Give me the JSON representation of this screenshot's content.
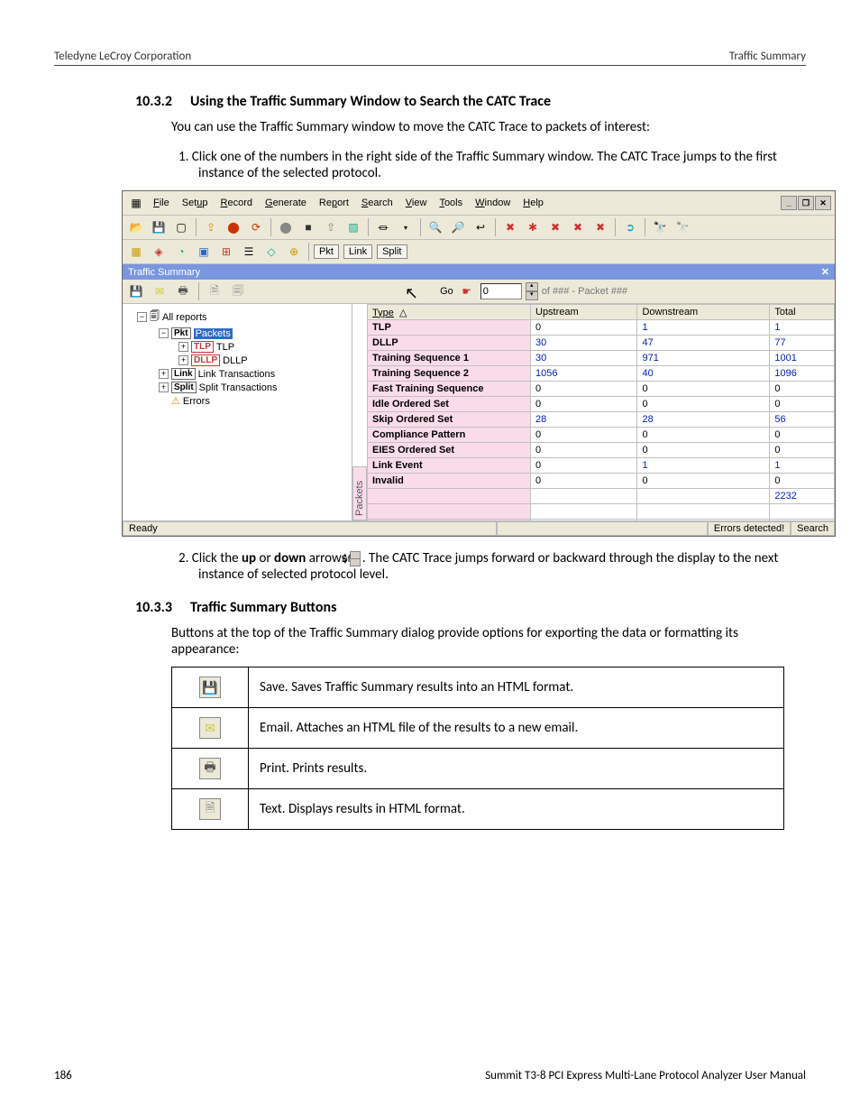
{
  "doc": {
    "header_left": "Teledyne LeCroy Corporation",
    "header_right": "Traffic Summary",
    "footer_left": "186",
    "footer_right": "Summit T3-8 PCI Express Multi-Lane Protocol Analyzer User Manual",
    "sec1_num": "10.3.2",
    "sec1_title": "Using the Traffic Summary Window to Search the CATC Trace",
    "sec1_intro": "You can use the Traffic Summary window to move the CATC Trace to packets of interest:",
    "sec1_step1": "1.  Click one of the numbers in the right side of the Traffic Summary window. The CATC Trace jumps to the first instance of the selected protocol.",
    "sec1_step2_a": "2.  Click the ",
    "sec1_step2_b": "up",
    "sec1_step2_c": " or ",
    "sec1_step2_d": "down",
    "sec1_step2_e": " arrows ",
    "sec1_step2_f": ". The CATC Trace jumps forward or backward through the display to the next instance of selected protocol level.",
    "sec2_num": "10.3.3",
    "sec2_title": "Traffic Summary Buttons",
    "sec2_intro": "Buttons at the top of the Traffic Summary dialog provide options for exporting the data or formatting its appearance:",
    "btn_save": "Save. Saves Traffic Summary results into an HTML format.",
    "btn_email": "Email. Attaches an HTML file of the results to a new email.",
    "btn_print": "Print. Prints results.",
    "btn_text": "Text. Displays results in HTML format."
  },
  "app": {
    "menus": [
      "File",
      "Setup",
      "Record",
      "Generate",
      "Report",
      "Search",
      "View",
      "Tools",
      "Window",
      "Help"
    ],
    "tabs": {
      "pkt": "Pkt",
      "link": "Link",
      "split": "Split"
    },
    "ts_title": "Traffic Summary",
    "go_label": "Go",
    "go_value": "0",
    "go_suffix": "of ### - Packet ###",
    "tree_root": "All reports",
    "tree_packets": "Packets",
    "tree_tlp": "TLP",
    "tree_dllp": "DLLP",
    "tree_link": "Link Transactions",
    "tree_split": "Split Transactions",
    "tree_errors": "Errors",
    "vertical_tab": "Packets",
    "cols": {
      "type": "Type",
      "up": "Upstream",
      "down": "Downstream",
      "total": "Total"
    },
    "rows": [
      {
        "t": "TLP",
        "u": "0",
        "d": "1",
        "tot": "1",
        "link": true
      },
      {
        "t": "DLLP",
        "u": "30",
        "d": "47",
        "tot": "77",
        "link": true
      },
      {
        "t": "Training Sequence 1",
        "u": "30",
        "d": "971",
        "tot": "1001",
        "link": true
      },
      {
        "t": "Training Sequence 2",
        "u": "1056",
        "d": "40",
        "tot": "1096",
        "link": true
      },
      {
        "t": "Fast Training Sequence",
        "u": "0",
        "d": "0",
        "tot": "0"
      },
      {
        "t": "Idle Ordered Set",
        "u": "0",
        "d": "0",
        "tot": "0"
      },
      {
        "t": "Skip Ordered Set",
        "u": "28",
        "d": "28",
        "tot": "56",
        "link": true
      },
      {
        "t": "Compliance Pattern",
        "u": "0",
        "d": "0",
        "tot": "0"
      },
      {
        "t": "EIES Ordered Set",
        "u": "0",
        "d": "0",
        "tot": "0"
      },
      {
        "t": "Link Event",
        "u": "0",
        "d": "1",
        "tot": "1",
        "link": true
      },
      {
        "t": "Invalid",
        "u": "0",
        "d": "0",
        "tot": "0"
      },
      {
        "t": "",
        "u": "",
        "d": "",
        "tot": "2232",
        "link": true
      },
      {
        "t": "",
        "u": "",
        "d": "",
        "tot": ""
      },
      {
        "t": "",
        "u": "",
        "d": "",
        "tot": ""
      }
    ],
    "status_ready": "Ready",
    "status_err": "Errors detected!",
    "status_search": "Search"
  },
  "inline_of": "of"
}
